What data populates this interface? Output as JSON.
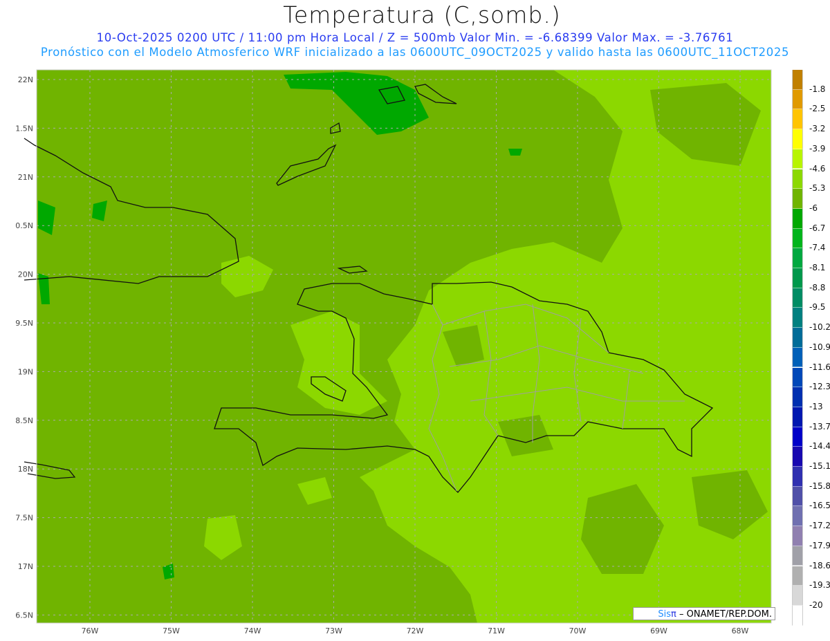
{
  "header": {
    "title": "Temperatura (C,somb.)",
    "line1": "10-Oct-2025  0200 UTC / 11:00 pm Hora Local / Z = 500mb  Valor Min. = -6.68399  Valor Max. = -3.76761",
    "line2": "Pronóstico con el Modelo Atmosferico WRF inicializado a las 0600UTC_09OCT2025 y valido hasta las  0600UTC_11OCT2025"
  },
  "map": {
    "lat_labels": [
      "22N",
      "1.5N",
      "21N",
      "0.5N",
      "20N",
      "9.5N",
      "19N",
      "8.5N",
      "18N",
      "7.5N",
      "17N",
      "6.5N"
    ],
    "lon_labels": [
      "76W",
      "75W",
      "74W",
      "73W",
      "72W",
      "71W",
      "70W",
      "69W",
      "68W"
    ],
    "background_color": "#70b400",
    "warm_color": "#8cd800",
    "cool_color": "#00a800"
  },
  "colorbar": {
    "labels": [
      "-1.8",
      "-2.5",
      "-3.2",
      "-3.9",
      "-4.6",
      "-5.3",
      "-6",
      "-6.7",
      "-7.4",
      "-8.1",
      "-8.8",
      "-9.5",
      "-10.2",
      "-10.9",
      "-11.6",
      "-12.3",
      "-13",
      "-13.7",
      "-14.4",
      "-15.1",
      "-15.8",
      "-16.5",
      "-17.2",
      "-17.9",
      "-18.6",
      "-19.3",
      "-20"
    ],
    "colors": [
      "#c08000",
      "#e09a00",
      "#ffc400",
      "#ffff00",
      "#b8f400",
      "#8cd800",
      "#70b400",
      "#00a800",
      "#00b41c",
      "#00a840",
      "#00984c",
      "#008c64",
      "#008080",
      "#006c98",
      "#0060b8",
      "#0048b8",
      "#0030b0",
      "#0018b0",
      "#0000c8",
      "#1808b0",
      "#3030b0",
      "#5050a8",
      "#7070b0",
      "#9080b0",
      "#a0a0a8",
      "#b0b0b0",
      "#d8d8d8",
      "#ffffff"
    ]
  },
  "credit": {
    "sis": "Sis",
    "pi": "π",
    "rest": " –  ONAMET/REP.DOM."
  }
}
